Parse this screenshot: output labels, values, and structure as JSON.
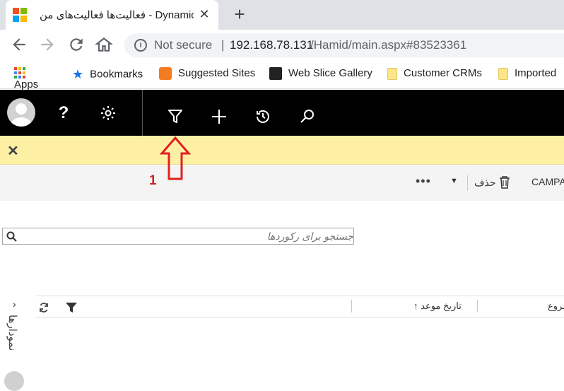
{
  "browser": {
    "tab_title": "فعالیت‌ها فعالیت‌های من - Dynamics CRM",
    "tab_close": "✕",
    "new_tab": "+",
    "address": {
      "security_label": "Not secure",
      "separator": "|",
      "host": "192.168.78.131",
      "path": "/Hamid/main.aspx#83523361"
    },
    "bookmarks": [
      "Apps",
      "Bookmarks",
      "Suggested Sites",
      "Web Slice Gallery",
      "Customer CRMs",
      "Imported"
    ]
  },
  "crm": {
    "nav_icons": [
      "avatar",
      "help-icon",
      "settings-icon",
      "filter-icon",
      "add-icon",
      "history-icon",
      "search-icon"
    ],
    "notification_close": "✕",
    "command_bar": {
      "more": "•••",
      "delete_label": "حذف",
      "campaign_label": "CAMPA"
    },
    "annotation_number": "1",
    "search": {
      "placeholder": "جستجو برای رکوردها"
    },
    "grid": {
      "columns": [
        "تاریخ موعد",
        "شروع"
      ],
      "sort_indicator": "↑"
    },
    "side_panel": {
      "label": "نمودارها",
      "chevron": "›"
    }
  },
  "colors": {
    "crm_nav_bg": "#000000",
    "notification_bg": "#fdf0a5",
    "annotation": "#cc1f1f"
  }
}
